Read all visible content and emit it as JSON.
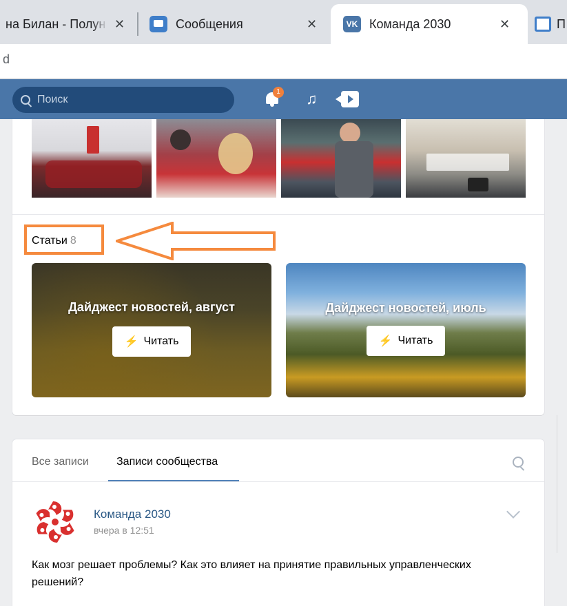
{
  "browser": {
    "tabs": [
      {
        "label": "на Билан - Полун",
        "close": "✕"
      },
      {
        "label": "Сообщения",
        "close": "✕"
      },
      {
        "label": "Команда 2030",
        "close": "✕",
        "favicon": "VK"
      },
      {
        "label": "П"
      }
    ],
    "address_fragment": "d"
  },
  "vk": {
    "search_placeholder": "Поиск",
    "notifications_badge": "1",
    "music_icon": "♫"
  },
  "articles": {
    "heading": "Статьи",
    "count": "8",
    "items": [
      {
        "title": "Дайджест новостей, август",
        "button": "Читать"
      },
      {
        "title": "Дайджест новостей, июль",
        "button": "Читать"
      }
    ],
    "bolt_icon": "⚡"
  },
  "wall": {
    "tabs": [
      {
        "label": "Все записи"
      },
      {
        "label": "Записи сообщества"
      }
    ],
    "post": {
      "author": "Команда 2030",
      "time": "вчера в 12:51",
      "text": "Как мозг решает проблемы? Как это влияет на принятие правильных управленческих решений?"
    }
  },
  "colors": {
    "vk_header": "#4a76a8",
    "highlight": "#f58a3e",
    "link": "#2a5885",
    "logo_red": "#d9302f"
  }
}
